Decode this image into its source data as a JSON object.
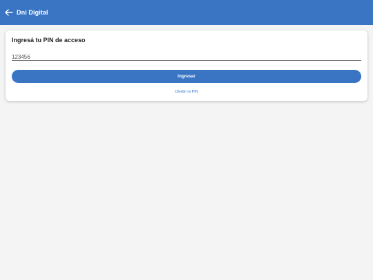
{
  "appbar": {
    "title": "Dni Digital",
    "back_icon": "arrow-left-icon",
    "color": "#3a75c4"
  },
  "card": {
    "title": "Ingresá tu PIN de acceso",
    "pin_value": "123456",
    "submit_label": "Ingresar",
    "forgot_label": "Olvidé mi PIN"
  },
  "colors": {
    "accent": "#3a75c4",
    "background": "#f4f4f4"
  }
}
